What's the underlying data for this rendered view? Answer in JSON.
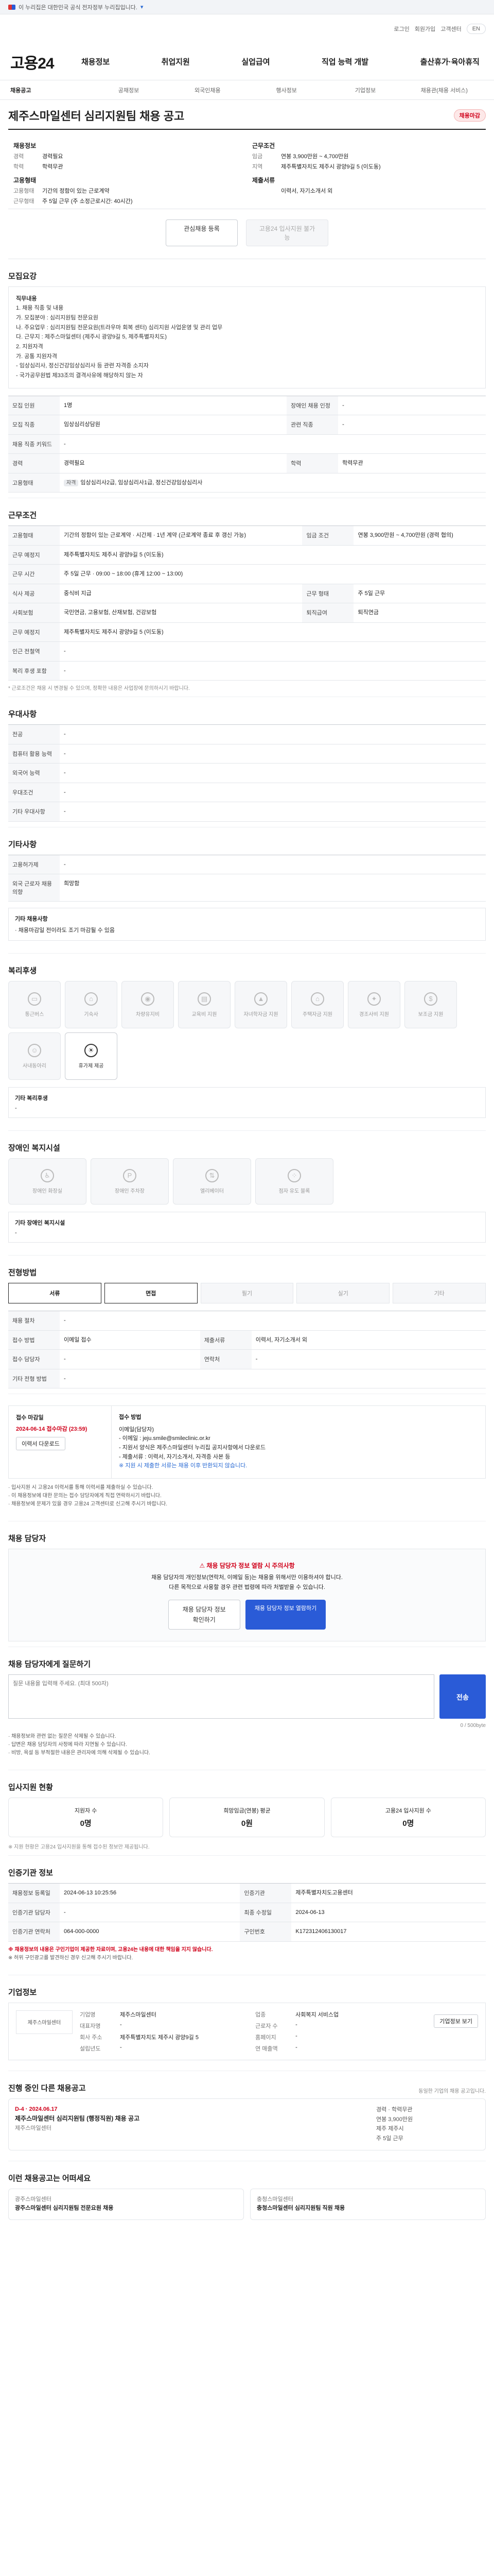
{
  "topbar": {
    "gov_text": "이 누리집은 대한민국 공식 전자정부 누리집입니다.",
    "check_link": "▾"
  },
  "util": {
    "items": [
      "로그인",
      "회원가입",
      "고객센터"
    ],
    "lang": "EN"
  },
  "gnb": {
    "logo": "고용24",
    "menu": [
      "채용정보",
      "취업지원",
      "실업급여",
      "직업 능력 개발",
      "출산휴가·육아휴직"
    ]
  },
  "subnav": [
    "채용공고",
    "공채정보",
    "외국인채용",
    "행사정보",
    "기업정보",
    "채용관(채용 서비스)"
  ],
  "job": {
    "title": "제주스마일센터 심리지원팀 채용 공고",
    "badge": "채용마감",
    "company_group": "채용정보",
    "company_rows": [
      {
        "k": "경력",
        "v": "경력필요"
      },
      {
        "k": "학력",
        "v": "학력무관"
      }
    ],
    "employ_group": "고용형태",
    "employ_rows": [
      {
        "k": "고용형태",
        "v": "기간의 정함이 있는 근로계약"
      },
      {
        "k": "근무형태",
        "v": "주 5일 근무 (주 소정근로시간: 40시간)"
      }
    ],
    "cond_group": "근무조건",
    "cond_rows": [
      {
        "k": "임금",
        "v": "연봉 3,900만원 ~ 4,700만원"
      },
      {
        "k": "지역",
        "v": "제주특별자치도 제주시 광양9길 5 (이도동)"
      }
    ],
    "deadline_group": "제출서류",
    "deadline_rows": [
      {
        "k": "",
        "v": "이력서, 자기소개서 외"
      }
    ],
    "btn_interest": "관심채용 등록",
    "btn_apply": "고용24 입사지원 불가능"
  },
  "recruit": {
    "heading": "모집요강",
    "desc_lines": [
      "직무내용",
      "1. 채용 직종 및 내용",
      " 가. 모집분야 : 심리지원팀 전문요원",
      " 나. 주요업무 : 심리지원팀 전문요원(트라우마 회복 센터) 심리지원 사업운영 및 관리 업무",
      " 다. 근무지 : 제주스마일센터 (제주시 광양9길 5, 제주특별자치도)",
      "2. 지원자격",
      " 가. 공통 지원자격",
      "  - 임상심리사, 정신건강임상심리사 등 관련 자격증 소지자",
      "  - 국가공무원법 제33조의 결격사유에 해당하지 않는 자"
    ],
    "rows": [
      {
        "k": "모집 인원",
        "v": "1명",
        "k2": "장애인 채용 인정",
        "v2": "-"
      },
      {
        "k": "모집 직종",
        "v": "임상심리상담원",
        "k2": "관련 직종",
        "v2": "-"
      },
      {
        "k": "채용 직종 키워드",
        "v": "-",
        "k2": "",
        "v2": ""
      },
      {
        "k": "경력",
        "v": "경력필요",
        "k2": "학력",
        "v2": "학력무관"
      },
      {
        "k": "고용형태",
        "v": "임상심리사2급, 임상심리사1급, 정신건강임상심리사",
        "k2": "",
        "v2": ""
      }
    ]
  },
  "work": {
    "heading": "근무조건",
    "rows": [
      {
        "k": "고용형태",
        "v": "기간의 정함이 있는 근로계약 · 시간제 · 1년 계약 (근로계약 종료 후 갱신 가능)",
        "k2": "임금 조건",
        "v2": "연봉 3,900만원 ~ 4,700만원 (경력 협의)"
      },
      {
        "k": "근무 예정지",
        "v": "제주특별자치도 제주시 광양9길 5 (이도동)",
        "k2": "",
        "v2": ""
      },
      {
        "k": "근무 시간",
        "v": "주 5일 근무 · 09:00 ~ 18:00 (휴게 12:00 ~ 13:00)",
        "k2": "",
        "v2": ""
      },
      {
        "k": "식사 제공",
        "v": "중식비 지급",
        "k2": "근무 형태",
        "v2": "주 5일 근무"
      },
      {
        "k": "사회보험",
        "v": "국민연금, 고용보험, 산재보험, 건강보험",
        "k2": "퇴직급여",
        "v2": "퇴직연금"
      },
      {
        "k": "근무 예정지",
        "v": "제주특별자치도 제주시 광양9길 5 (이도동)",
        "k2": "",
        "v2": ""
      },
      {
        "k": "인근 전철역",
        "v": "-",
        "k2": "",
        "v2": ""
      },
      {
        "k": "복리 후생 포함",
        "v": "-",
        "k2": "",
        "v2": ""
      }
    ],
    "note": "* 근로조건은 채용 시 변경될 수 있으며, 정확한 내용은 사업장에 문의하시기 바랍니다."
  },
  "prefer": {
    "heading": "우대사항",
    "rows": [
      {
        "k": "전공",
        "v": "-"
      },
      {
        "k": "컴퓨터 활용 능력",
        "v": "-"
      },
      {
        "k": "외국어 능력",
        "v": "-"
      },
      {
        "k": "우대조건",
        "v": "-"
      },
      {
        "k": "기타 우대사항",
        "v": "-"
      }
    ]
  },
  "etc": {
    "heading": "기타사항",
    "rows": [
      {
        "k": "고용허가제",
        "v": "-"
      },
      {
        "k": "외국 근로자 채용 의향",
        "v": "희망함"
      }
    ],
    "box_title": "기타 채용사항",
    "box_body": "· 채용마감일 전이라도 조기 마감될 수 있음"
  },
  "welfare": {
    "heading": "복리후생",
    "tiles": [
      "통근버스",
      "기숙사",
      "차량유지비",
      "교육비 지원",
      "자녀학자금 지원",
      "주택자금 지원",
      "경조사비 지원",
      "보조금 지원",
      "사내동아리",
      "휴가제 제공"
    ],
    "active_index": 9,
    "box_title": "기타 복리후생",
    "box_body": "-"
  },
  "disabled_welfare": {
    "heading": "장애인 복지시설",
    "tiles": [
      "장애인 화장실",
      "장애인 주차장",
      "엘리베이터",
      "점자 유도 블록"
    ],
    "box_title": "기타 장애인 복지시설",
    "box_body": "-"
  },
  "process": {
    "heading": "전형방법",
    "steps": [
      "서류",
      "면접",
      "필기",
      "실기",
      "기타"
    ],
    "active": [
      0,
      1
    ],
    "rows": [
      {
        "k": "채용 절차",
        "v": "-"
      },
      {
        "k": "접수 방법",
        "v": "이메일 접수",
        "k2": "제출서류",
        "v2": "이력서, 자기소개서 외"
      },
      {
        "k": "접수 담당자",
        "v": "-",
        "k2": "연락처",
        "v2": "-"
      },
      {
        "k": "기타 전형 방법",
        "v": "-",
        "k2": "",
        "v2": ""
      }
    ]
  },
  "apply": {
    "left_title": "접수 마감일",
    "left_deadline": "2024-06-14 접수마감 (23:59)",
    "left_btn": "이력서 다운로드",
    "right_title": "접수 방법",
    "right_lines": [
      "이메일(담당자)",
      "- 이메일 : jeju.smile@smileclinic.or.kr",
      "- 지원서 양식은 제주스마일센터 누리집 공지사항에서 다운로드",
      "- 제출서류 : 이력서, 자기소개서, 자격증 사본 등"
    ],
    "right_warn": "※ 지원 시 제출한 서류는 채용 이후 반환되지 않습니다.",
    "bullets": [
      "· 입사지원 시 고용24 이력서를 통해 이력서를 제출하실 수 있습니다.",
      "· 이 채용정보에 대한 문의는 접수 담당자에게 직접 연락하시기 바랍니다.",
      "· 채용정보에 문제가 있을 경우 고용24 고객센터로 신고해 주시기 바랍니다."
    ]
  },
  "contact": {
    "heading": "채용 담당자",
    "alert_title": "채용 담당자 정보 열람 시 주의사항",
    "alert_lines": [
      "채용 담당자의 개인정보(연락처, 이메일 등)는 채용을 위해서만 이용하셔야 합니다.",
      "다른 목적으로 사용할 경우 관련 법령에 따라 처벌받을 수 있습니다."
    ],
    "btn_view": "채용 담당자 정보 확인하기",
    "btn_agree": "채용 담당자 정보 열람하기"
  },
  "qa": {
    "heading": "채용 담당자에게 질문하기",
    "placeholder": "질문 내용을 입력해 주세요. (최대 500자)",
    "send": "전송",
    "count": "0 / 500byte",
    "notes": [
      "· 채용정보와 관련 없는 질문은 삭제될 수 있습니다.",
      "· 답변은 채용 담당자의 사정에 따라 지연될 수 있습니다.",
      "· 비방, 욕설 등 부적절한 내용은 관리자에 의해 삭제될 수 있습니다."
    ]
  },
  "status": {
    "heading": "입사지원 현황",
    "cards": [
      {
        "label": "지원자 수",
        "value": "0명"
      },
      {
        "label": "희망임금(연봉) 평균",
        "value": "0원"
      },
      {
        "label": "고용24 입사지원 수",
        "value": "0명"
      }
    ],
    "note": "※ 지원 현황은 고용24 입사지원을 통해 접수된 정보만 제공됩니다."
  },
  "info": {
    "heading": "인증기관 정보",
    "rows": [
      {
        "k": "채용정보 등록일",
        "v": "2024-06-13 10:25:56",
        "k2": "인증기관",
        "v2": "제주특별자치도고용센터"
      },
      {
        "k": "인증기관 담당자",
        "v": "-",
        "k2": "최종 수정일",
        "v2": "2024-06-13"
      },
      {
        "k": "인증기관 연락처",
        "v": "064-000-0000",
        "k2": "구인번호",
        "v2": "K172312406130017"
      }
    ],
    "notes": [
      "※ 채용정보의 내용은 구인기업이 제공한 자료이며, 고용24는 내용에 대한 책임을 지지 않습니다.",
      "※ 허위 구인광고를 발견하신 경우 신고해 주시기 바랍니다."
    ]
  },
  "corp": {
    "heading": "기업정보",
    "logo": "제주스마일센터",
    "rows": [
      {
        "k": "기업명",
        "v": "제주스마일센터",
        "k2": "업종",
        "v2": "사회복지 서비스업"
      },
      {
        "k": "대표자명",
        "v": "-",
        "k2": "근로자 수",
        "v2": "-"
      },
      {
        "k": "회사 주소",
        "v": "제주특별자치도 제주시 광양9길 5",
        "k2": "홈페이지",
        "v2": "-"
      },
      {
        "k": "설립년도",
        "v": "-",
        "k2": "연 매출액",
        "v2": "-"
      }
    ],
    "btn": "기업정보 보기"
  },
  "related": {
    "heading": "진행 중인 다른 채용공고",
    "sub": "동일한 기업의 채용 공고입니다.",
    "card_badge": "D-4 · 2024.06.17",
    "card_title": "제주스마일센터 심리지원팀 (행정직원) 채용 공고",
    "card_sub": "제주스마일센터",
    "side": [
      "경력 · 학력무관",
      "연봉 3,900만원",
      "제주 제주시",
      "주 5일 근무"
    ]
  },
  "recommend": {
    "heading": "이런 채용공고는 어떠세요",
    "cards": [
      {
        "title": "광주스마일센터 심리지원팀 전문요원 채용",
        "company": "광주스마일센터"
      },
      {
        "title": "충청스마일센터 심리지원팀 직원 채용",
        "company": "충청스마일센터"
      }
    ]
  }
}
